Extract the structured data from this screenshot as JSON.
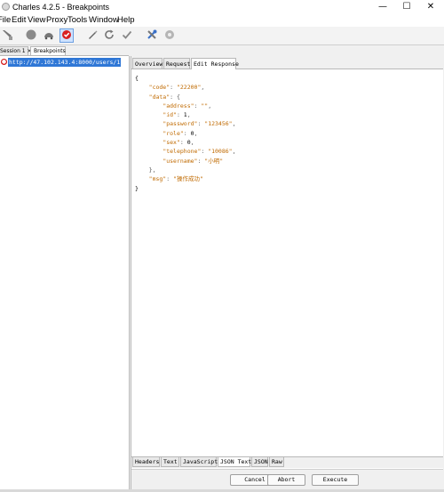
{
  "window": {
    "title": "Charles 4.2.5 - Breakpoints",
    "minimize": "—",
    "maximize": "☐",
    "close": "✕"
  },
  "menu": [
    "File",
    "Edit",
    "View",
    "Proxy",
    "Tools",
    "Window",
    "Help"
  ],
  "toolbar": {
    "icons": [
      "brush-icon",
      "record-icon",
      "throttle-icon",
      "breakpoints-icon",
      "pen-icon",
      "refresh-icon",
      "check-icon",
      "tools-icon",
      "settings-icon"
    ],
    "active": "breakpoints-icon"
  },
  "left_tabs": [
    "Session 1 ×",
    "Breakpoints"
  ],
  "left_tree": {
    "item": "http://47.102.143.4:8000/users/1"
  },
  "right_tabs": [
    "Overview",
    "Request",
    "Edit Response"
  ],
  "response": {
    "open_brace": "{",
    "code_key": "\"code\"",
    "code_val": "\"22200\"",
    "data_key": "\"data\"",
    "address_key": "\"address\"",
    "address_val": "\"\"",
    "id_key": "\"id\"",
    "id_val": "1",
    "password_key": "\"password\"",
    "password_val": "\"123456\"",
    "role_key": "\"role\"",
    "role_val": "0",
    "sex_key": "\"sex\"",
    "sex_val": "0",
    "telephone_key": "\"telephone\"",
    "telephone_val": "\"10086\"",
    "username_key": "\"username\"",
    "username_val": "\"小明\"",
    "msg_key": "\"msg\"",
    "msg_val": "\"操作成功\"",
    "close_brace": "}"
  },
  "bottom_tabs": [
    "Headers",
    "Text",
    "JavaScript",
    "JSON Text",
    "JSON",
    "Raw"
  ],
  "active_bottom_tab": "JSON Text",
  "buttons": {
    "cancel": "Cancel",
    "abort": "Abort",
    "execute": "Execute"
  }
}
